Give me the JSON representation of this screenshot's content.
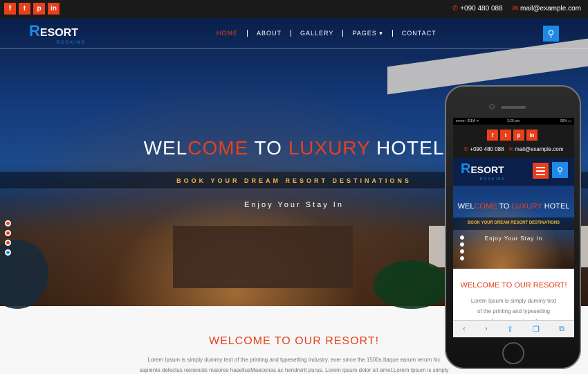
{
  "topbar": {
    "social": [
      {
        "icon": "facebook-icon",
        "glyph": "f"
      },
      {
        "icon": "twitter-icon",
        "glyph": "t"
      },
      {
        "icon": "pinterest-icon",
        "glyph": "p"
      },
      {
        "icon": "linkedin-icon",
        "glyph": "in"
      }
    ],
    "phone": "+090 480 088",
    "email": "mail@example.com"
  },
  "brand": {
    "logo_initial": "R",
    "logo_rest": "ESORT",
    "logo_sub": "BOOKING"
  },
  "nav": {
    "items": [
      "HOME",
      "ABOUT",
      "GALLERY",
      "PAGES ▾",
      "CONTACT"
    ],
    "active": "HOME"
  },
  "hero": {
    "headline_parts": [
      "WEL",
      "COME",
      " TO ",
      "LUXURY",
      " HOTEL"
    ],
    "tagline": "BOOK YOUR DREAM RESORT DESTINATIONS",
    "subtitle": "Enjoy Your Stay In"
  },
  "section": {
    "title": "WELCOME TO OUR RESORT!",
    "lorem1": "Lorem Ipsum is simply dummy text of the printing and typesetting industry. ever since the 1500s.Itaque earum rerum hic",
    "lorem2": "sapiente delectus reiciendis maiores hasellusMaecenas ac hendrerit purus. Lorem ipsum dolor sit amet.Lorem Ipsum is simply"
  },
  "phone_mock": {
    "status_left": "●●●●○ IDEA ᯤ",
    "status_time": "3:20 pm",
    "status_right": "90% ▭",
    "text_lines": [
      "Lorem Ipsum is simply dummy text",
      "of the printing and typesetting",
      "industry. ever since the"
    ]
  },
  "colors": {
    "accent": "#e8401c",
    "brand": "#1e8ae6",
    "gold": "#f0b93c"
  }
}
